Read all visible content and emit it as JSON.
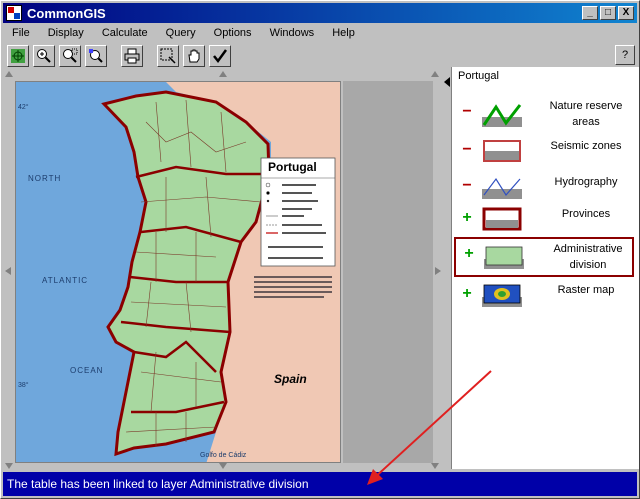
{
  "window": {
    "title": "CommonGIS",
    "controls": [
      "_",
      "□",
      "X"
    ]
  },
  "menu": [
    "File",
    "Display",
    "Calculate",
    "Query",
    "Options",
    "Windows",
    "Help"
  ],
  "toolbar": {
    "tools": [
      "globe-icon",
      "zoom-in-icon",
      "zoom-region-icon",
      "zoom-reset-icon",
      "print-icon",
      "select-rect-icon",
      "hand-icon",
      "check-icon"
    ]
  },
  "help": {
    "label": "?"
  },
  "map": {
    "country_title": "Portugal",
    "spain_label": "Spain",
    "north_label": "NORTH",
    "atlantic_label": "ATLANTIC",
    "ocean_label": "OCEAN",
    "lat_42": "42°",
    "lat_38": "38°",
    "golfo_label": "Golfo de Cádiz"
  },
  "legend": {
    "title": "Portugal",
    "layers": [
      {
        "sign": "−",
        "label_l1": "Nature reserve",
        "label_l2": "areas",
        "symbol": "line-green"
      },
      {
        "sign": "−",
        "label_l1": "Seismic zones",
        "label_l2": "",
        "symbol": "rect-red-outline"
      },
      {
        "sign": "−",
        "label_l1": "Hydrography",
        "label_l2": "",
        "symbol": "line-blue"
      },
      {
        "sign": "+",
        "label_l1": "Provinces",
        "label_l2": "",
        "symbol": "rect-darkred"
      },
      {
        "sign": "+",
        "label_l1": "Administrative",
        "label_l2": "division",
        "symbol": "rect-green"
      },
      {
        "sign": "+",
        "label_l1": "Raster map",
        "label_l2": "",
        "symbol": "raster"
      }
    ]
  },
  "status": {
    "text": "The table has been linked to layer Administrative division"
  },
  "colors": {
    "status_bg": "#0000a8",
    "province_border": "#8b0000",
    "admin_fill": "#a8d8a0",
    "sea": "#6fa7dc"
  }
}
